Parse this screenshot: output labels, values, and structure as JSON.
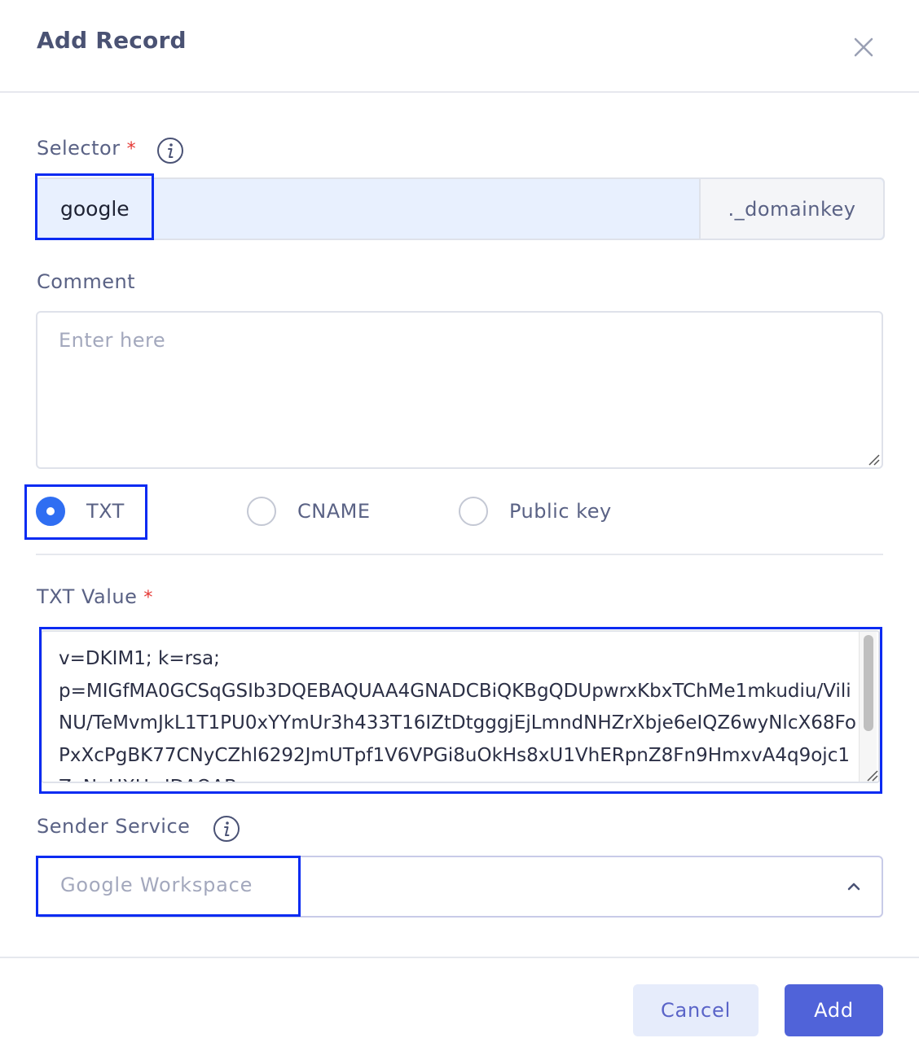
{
  "dialog": {
    "title": "Add Record"
  },
  "selector": {
    "label": "Selector",
    "required_mark": "*",
    "value": "google",
    "suffix": "._domainkey"
  },
  "comment": {
    "label": "Comment",
    "placeholder": "Enter here"
  },
  "record_type": {
    "options": [
      {
        "label": "TXT",
        "checked": true
      },
      {
        "label": "CNAME",
        "checked": false
      },
      {
        "label": "Public key",
        "checked": false
      }
    ]
  },
  "txt_value": {
    "label": "TXT Value",
    "required_mark": "*",
    "value": "v=DKIM1; k=rsa;\np=MIGfMA0GCSqGSIb3DQEBAQUAA4GNADCBiQKBgQDUpwrxKbxTChMe1mkudiu/ViliNU/TeMvmJkL1T1PU0xYYmUr3h433T16IZtDtgggjEjLmndNHZrXbje6eIQZ6wyNlcX68FoPxXcPgBK77CNyCZhl6292JmUTpf1V6VPGi8uOkHs8xU1VhERpnZ8Fn9HmxvA4q9ojc1ZaNaUXHwIDAQAB"
  },
  "sender_service": {
    "label": "Sender Service",
    "value": "Google Workspace"
  },
  "buttons": {
    "cancel": "Cancel",
    "add": "Add"
  },
  "colors": {
    "primary": "#5063d9",
    "highlight": "#0a2bf2",
    "required": "#e53935",
    "radio_checked": "#2f6ef2"
  }
}
